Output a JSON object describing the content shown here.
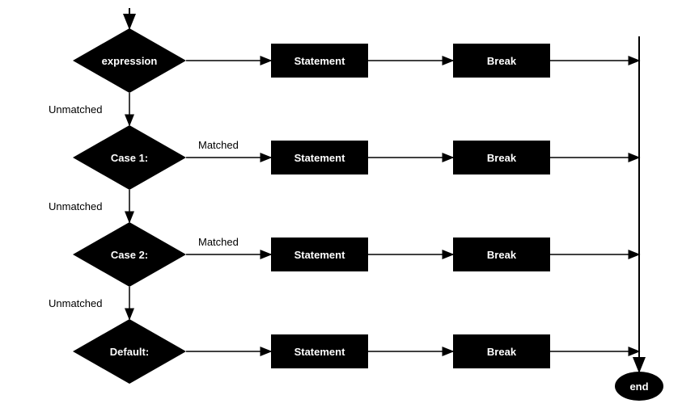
{
  "diagram": {
    "rows": [
      {
        "decision": "expression",
        "statement": "Statement",
        "break": "Break",
        "matched_label": "",
        "unmatched_label": "Unmatched"
      },
      {
        "decision": "Case 1:",
        "statement": "Statement",
        "break": "Break",
        "matched_label": "Matched",
        "unmatched_label": "Unmatched"
      },
      {
        "decision": "Case 2:",
        "statement": "Statement",
        "break": "Break",
        "matched_label": "Matched",
        "unmatched_label": "Unmatched"
      },
      {
        "decision": "Default:",
        "statement": "Statement",
        "break": "Break",
        "matched_label": "",
        "unmatched_label": ""
      }
    ],
    "end": "end"
  }
}
